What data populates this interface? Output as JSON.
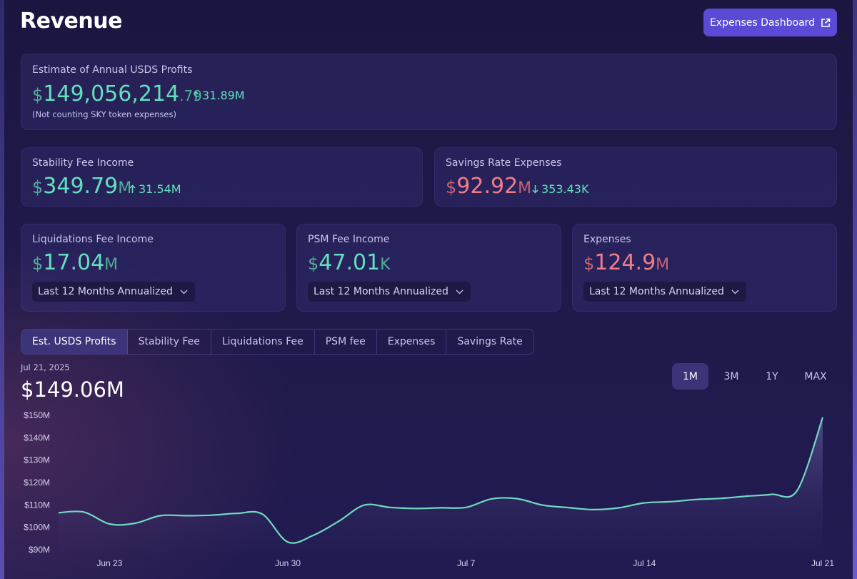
{
  "header": {
    "title": "Revenue",
    "expenses_button": "Expenses Dashboard",
    "expenses_button_icon": "external-link-icon"
  },
  "profits": {
    "label": "Estimate of Annual USDS Profits",
    "currency": "$",
    "value_main": "149,056,214",
    "value_decimal": ".79",
    "delta": "31.89M",
    "delta_direction": "up",
    "note": "(Not counting SKY token expenses)"
  },
  "stability": {
    "label": "Stability Fee Income",
    "currency": "$",
    "value": "349.79",
    "unit": "M",
    "delta": "31.54M",
    "delta_direction": "up"
  },
  "savings": {
    "label": "Savings Rate Expenses",
    "currency": "$",
    "value": "92.92",
    "unit": "M",
    "delta": "353.43K",
    "delta_direction": "down"
  },
  "liquidations": {
    "label": "Liquidations Fee Income",
    "currency": "$",
    "value": "17.04",
    "unit": "M",
    "period": "Last 12 Months Annualized"
  },
  "psm": {
    "label": "PSM Fee Income",
    "currency": "$",
    "value": "47.01",
    "unit": "K",
    "period": "Last 12 Months Annualized"
  },
  "expenses": {
    "label": "Expenses",
    "currency": "$",
    "value": "124.9",
    "unit": "M",
    "period": "Last 12 Months Annualized"
  },
  "tabs": [
    {
      "label": "Est. USDS Profits",
      "active": true
    },
    {
      "label": "Stability Fee"
    },
    {
      "label": "Liquidations Fee"
    },
    {
      "label": "PSM fee"
    },
    {
      "label": "Expenses"
    },
    {
      "label": "Savings Rate"
    }
  ],
  "chart_header": {
    "date": "Jul 21, 2025",
    "value": "$149.06M"
  },
  "ranges": [
    {
      "label": "1M",
      "active": true
    },
    {
      "label": "3M"
    },
    {
      "label": "1Y"
    },
    {
      "label": "MAX"
    }
  ],
  "colors": {
    "accent": "#5b4ad6",
    "positive": "#62e0bd",
    "negative": "#f07c8a",
    "line": "#6fd9c0"
  },
  "chart_data": {
    "type": "area",
    "title": "",
    "xlabel": "",
    "ylabel": "",
    "ylim": [
      90,
      150
    ],
    "y_unit": "M",
    "y_ticks": [
      {
        "value": 150,
        "label": "$150M"
      },
      {
        "value": 140,
        "label": "$140M"
      },
      {
        "value": 130,
        "label": "$130M"
      },
      {
        "value": 120,
        "label": "$120M"
      },
      {
        "value": 110,
        "label": "$110M"
      },
      {
        "value": 100,
        "label": "$100M"
      },
      {
        "value": 90,
        "label": "$90M"
      }
    ],
    "x_ticks": [
      "Jun 23",
      "Jun 30",
      "Jul 7",
      "Jul 14",
      "Jul 21"
    ],
    "x": [
      "2025-06-21",
      "2025-06-22",
      "2025-06-23",
      "2025-06-24",
      "2025-06-25",
      "2025-06-26",
      "2025-06-27",
      "2025-06-28",
      "2025-06-29",
      "2025-06-30",
      "2025-07-01",
      "2025-07-02",
      "2025-07-03",
      "2025-07-04",
      "2025-07-05",
      "2025-07-06",
      "2025-07-07",
      "2025-07-08",
      "2025-07-09",
      "2025-07-10",
      "2025-07-11",
      "2025-07-12",
      "2025-07-13",
      "2025-07-14",
      "2025-07-15",
      "2025-07-16",
      "2025-07-17",
      "2025-07-18",
      "2025-07-19",
      "2025-07-20",
      "2025-07-21"
    ],
    "series": [
      {
        "values": [
          106.5,
          106.8,
          101.5,
          101.8,
          105.2,
          105.2,
          105.4,
          106.2,
          105.9,
          93.4,
          96.4,
          102.7,
          109.9,
          108.9,
          108.4,
          108.7,
          108.9,
          112.7,
          112.8,
          109.9,
          108.8,
          107.9,
          108.7,
          110.9,
          111.4,
          112.4,
          112.9,
          113.9,
          114.7,
          116.5,
          149.1
        ]
      }
    ]
  }
}
